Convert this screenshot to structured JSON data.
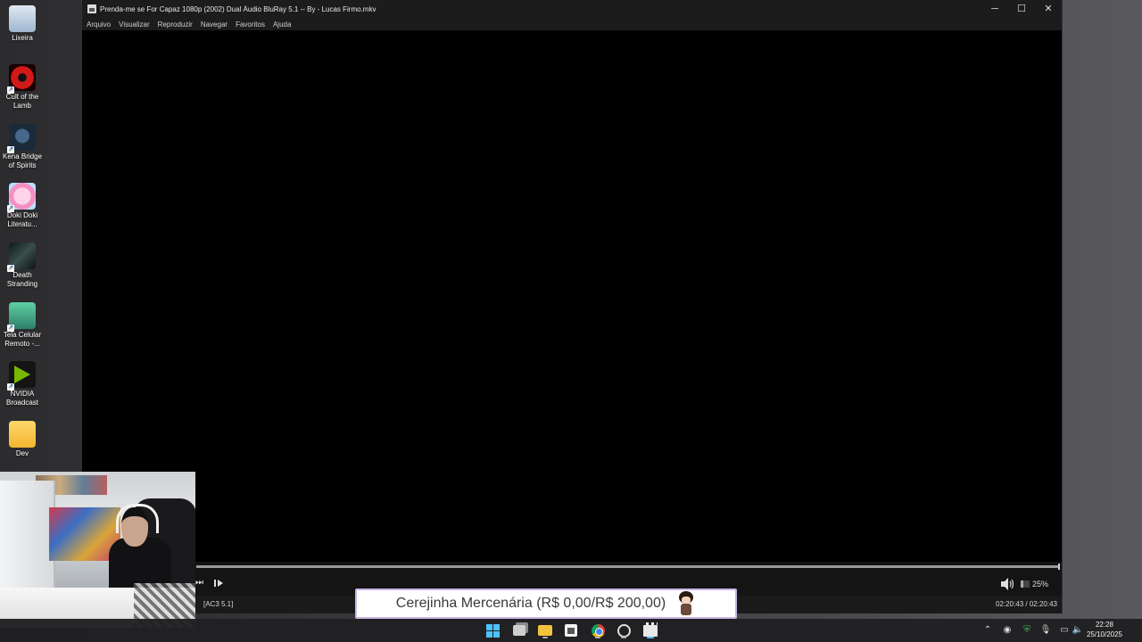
{
  "desktop": {
    "icons": [
      {
        "label": "Lixeira",
        "icon": "recycle-bin-icon"
      },
      {
        "label": "Cult of the Lamb",
        "icon": "cult-of-the-lamb-icon"
      },
      {
        "label": "Kena Bridge of Spirits",
        "icon": "kena-icon"
      },
      {
        "label": "Doki Doki Literatu...",
        "icon": "doki-doki-icon"
      },
      {
        "label": "Death Stranding",
        "icon": "death-stranding-icon"
      },
      {
        "label": "Tela Celular Remoto -...",
        "icon": "phone-mirror-icon"
      },
      {
        "label": "NVIDIA Broadcast",
        "icon": "nvidia-broadcast-icon"
      },
      {
        "label": "Dev",
        "icon": "folder-icon"
      }
    ]
  },
  "player": {
    "title": "Prenda-me se For Capaz 1080p (2002) Dual Áudio BluRay 5.1 -- By - Lucas Firmo.mkv",
    "menu": [
      "Arquivo",
      "Visualizar",
      "Reproduzir",
      "Navegar",
      "Favoritos",
      "Ajuda"
    ],
    "progress_fraction": 1.0,
    "volume_label": "25%",
    "volume_fraction": 0.25,
    "audio_track": "[AC3 5.1]",
    "time": "02:20:43 / 02:20:43"
  },
  "overlay": {
    "goal_text": "Cerejinha Mercenária (R$ 0,00/R$ 200,00)"
  },
  "taskbar": {
    "apps": [
      "start-icon",
      "task-view-icon",
      "file-explorer-icon",
      "store-icon",
      "chrome-icon",
      "obs-icon",
      "media-player-icon"
    ],
    "clock_time": "22:28",
    "clock_date": "25/10/2025"
  }
}
